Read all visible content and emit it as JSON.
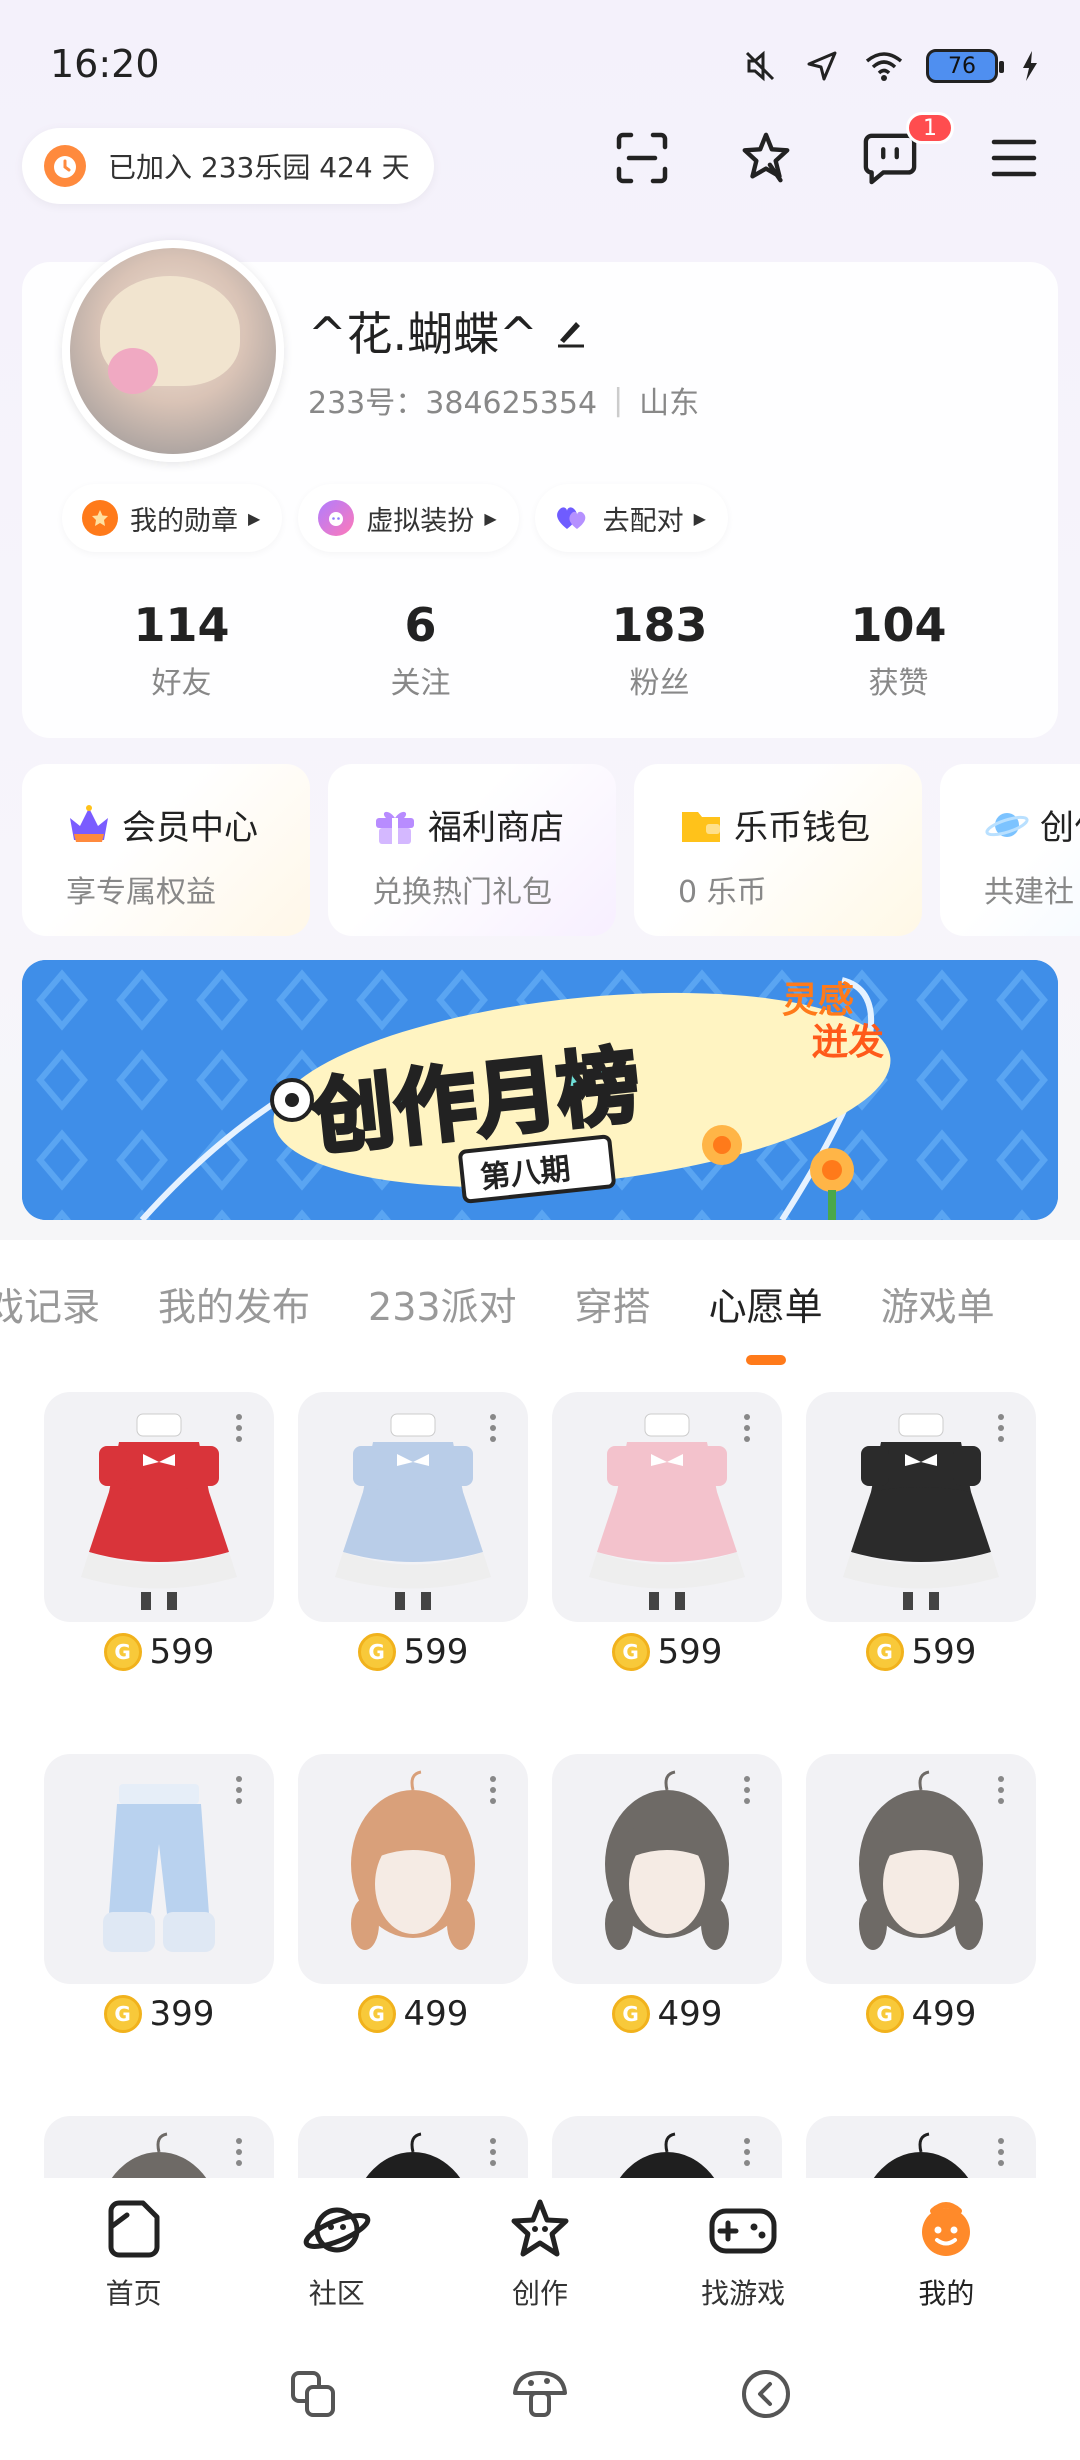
{
  "status_bar": {
    "time": "16:20",
    "battery": "76"
  },
  "header": {
    "park_text": "已加入 233乐园 424 天",
    "message_badge": "1"
  },
  "profile": {
    "name": "^花.蝴蝶^",
    "id_label": "233号：",
    "id": "384625354",
    "location": "山东",
    "chips": [
      {
        "label": "我的勋章",
        "icon": "medal-icon",
        "color": "#ff7a1a"
      },
      {
        "label": "虚拟装扮",
        "icon": "dress-up-icon",
        "color": "#8d7cff"
      },
      {
        "label": "去配对",
        "icon": "hearts-icon",
        "color": "#8a6bff"
      }
    ],
    "stats": [
      {
        "value": "114",
        "label": "好友"
      },
      {
        "value": "6",
        "label": "关注"
      },
      {
        "value": "183",
        "label": "粉丝"
      },
      {
        "value": "104",
        "label": "获赞"
      }
    ]
  },
  "services": [
    {
      "title": "会员中心",
      "desc": "享专属权益",
      "icon": "vip-crown-icon",
      "color": "#7a5cff"
    },
    {
      "title": "福利商店",
      "desc": "兑换热门礼包",
      "icon": "gift-icon",
      "color": "#b88cff"
    },
    {
      "title": "乐币钱包",
      "desc": "0 乐币",
      "icon": "wallet-icon",
      "color": "#ffc21a"
    },
    {
      "title": "创作",
      "desc": "共建社",
      "icon": "planet-icon",
      "color": "#7cc3ff"
    }
  ],
  "banner": {
    "title": "创作月榜",
    "issue": "第八期",
    "tag_line1": "灵感",
    "tag_line2": "迸发"
  },
  "tabs": [
    {
      "label": "戏记录",
      "active": false
    },
    {
      "label": "我的发布",
      "active": false
    },
    {
      "label": "233派对",
      "active": false
    },
    {
      "label": "穿搭",
      "active": false
    },
    {
      "label": "心愿单",
      "active": true
    },
    {
      "label": "游戏单",
      "active": false
    }
  ],
  "wishlist": [
    {
      "price": "599",
      "kind": "dress",
      "color": "#d9343a"
    },
    {
      "price": "599",
      "kind": "dress",
      "color": "#b9cde8"
    },
    {
      "price": "599",
      "kind": "dress",
      "color": "#f3c2cc"
    },
    {
      "price": "599",
      "kind": "dress",
      "color": "#2b2b2b"
    },
    {
      "price": "399",
      "kind": "pants",
      "color": "#b9d2ef"
    },
    {
      "price": "499",
      "kind": "hair",
      "color": "#d9a07a"
    },
    {
      "price": "499",
      "kind": "hair",
      "color": "#6e6a66"
    },
    {
      "price": "499",
      "kind": "hair",
      "color": "#6e6a66"
    },
    {
      "price": "",
      "kind": "hair",
      "color": "#6e6a66"
    },
    {
      "price": "",
      "kind": "hair",
      "color": "#1f1f1f"
    },
    {
      "price": "",
      "kind": "hair",
      "color": "#1f1f1f"
    },
    {
      "price": "",
      "kind": "hair",
      "color": "#1f1f1f"
    }
  ],
  "coin_symbol": "G",
  "bottom_nav": [
    {
      "label": "首页",
      "icon": "home-icon",
      "active": false
    },
    {
      "label": "社区",
      "icon": "community-planet-icon",
      "active": false
    },
    {
      "label": "创作",
      "icon": "create-star-icon",
      "active": false
    },
    {
      "label": "找游戏",
      "icon": "gamepad-icon",
      "active": false
    },
    {
      "label": "我的",
      "icon": "profile-face-icon",
      "active": true
    }
  ],
  "accent_color": "#ff7a1a"
}
